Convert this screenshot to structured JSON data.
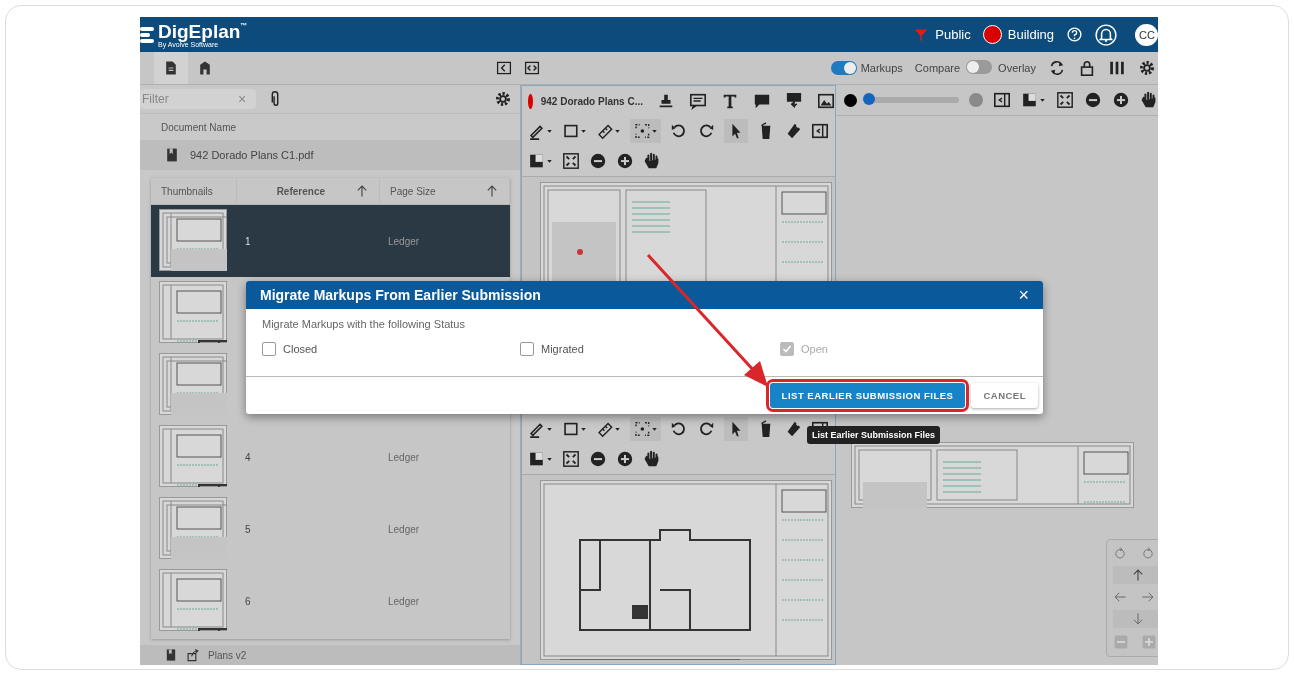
{
  "app": {
    "logo": "DigEplan",
    "logo_mark": "™",
    "tagline": "By Avolve Software"
  },
  "header": {
    "visibility": "Public",
    "status": "Building",
    "avatar": "CC"
  },
  "toolbar": {
    "markups": {
      "label": "Markups",
      "on": true
    },
    "compare_label": "Compare",
    "overlay": {
      "label": "Overlay",
      "on": false
    }
  },
  "left_panel": {
    "filter": {
      "placeholder": "Filter",
      "clear": "×"
    },
    "document_column": "Document Name",
    "documents": [
      {
        "name": "942 Dorado Plans C1.pdf"
      }
    ],
    "thumbnails": {
      "columns": [
        "Thumbnails",
        "Reference",
        "Page Size"
      ],
      "rows": [
        {
          "reference": "1",
          "page_size": "Ledger",
          "selected": true
        },
        {
          "selected": false
        },
        {
          "selected": false
        },
        {
          "reference": "4",
          "page_size": "Ledger",
          "selected": false
        },
        {
          "reference": "5",
          "page_size": "Ledger",
          "selected": false
        },
        {
          "reference": "6",
          "page_size": "Ledger",
          "selected": false
        }
      ]
    },
    "footer": "Plans v2"
  },
  "viewer": {
    "title": "942 Dorado Plans C...",
    "slider": {
      "level": 0.02
    }
  },
  "dialog": {
    "title": "Migrate Markups From Earlier Submission",
    "close": "×",
    "prompt": "Migrate Markups with the following Status",
    "options": [
      {
        "label": "Closed",
        "checked": false,
        "disabled": false
      },
      {
        "label": "Migrated",
        "checked": false,
        "disabled": false
      },
      {
        "label": "Open",
        "checked": true,
        "disabled": true
      }
    ],
    "buttons": [
      {
        "label": "LIST EARLIER SUBMISSION FILES",
        "kind": "primary",
        "highlighted": true
      },
      {
        "label": "CANCEL",
        "kind": "secondary",
        "highlighted": false
      }
    ],
    "tooltip": "List Earlier Submission Files"
  }
}
